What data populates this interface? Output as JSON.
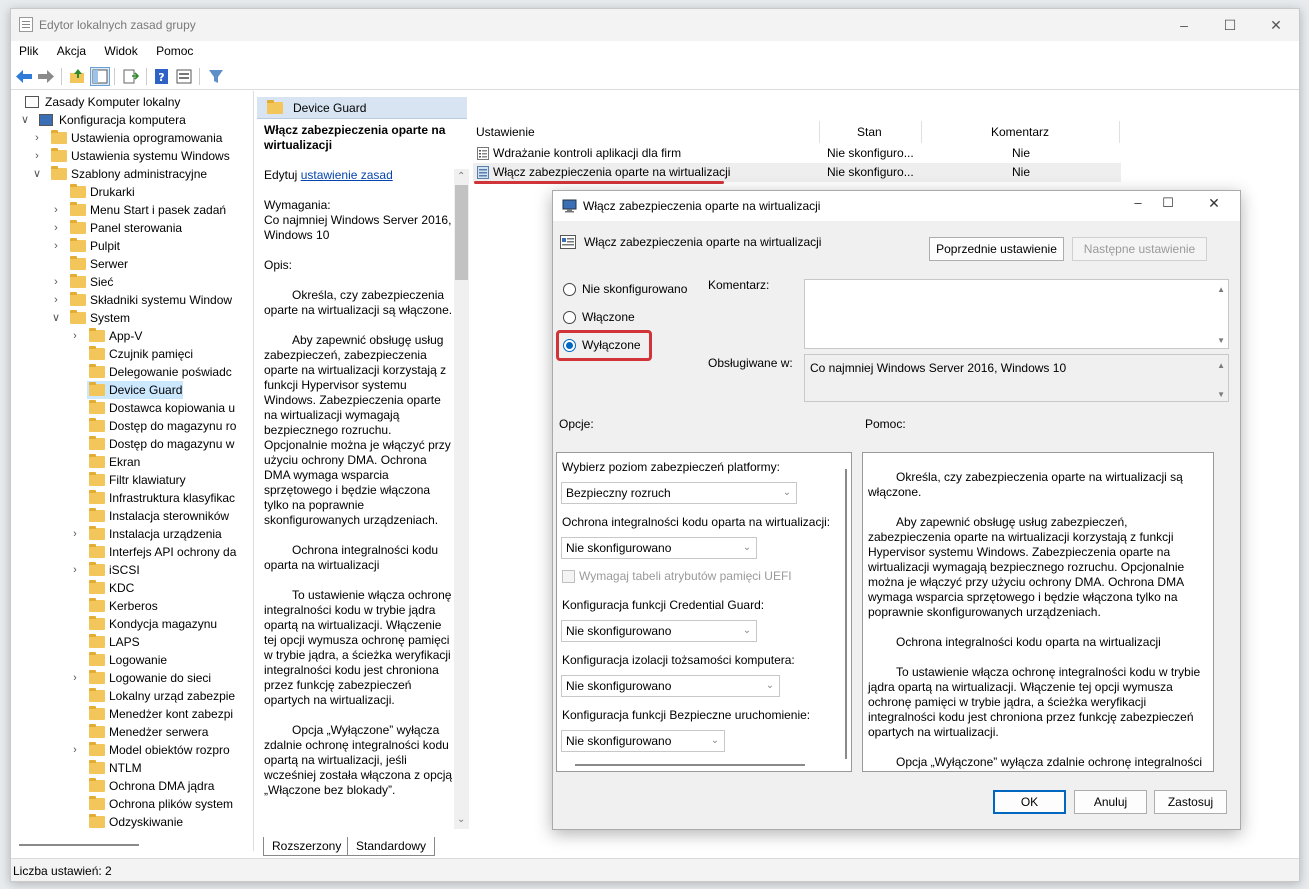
{
  "window": {
    "title": "Edytor lokalnych zasad grupy"
  },
  "menu": [
    "Plik",
    "Akcja",
    "Widok",
    "Pomoc"
  ],
  "tree": {
    "items": [
      {
        "label": "Zasady Komputer lokalny",
        "level": 0,
        "expand": "",
        "icon": "computer-icon"
      },
      {
        "label": "Konfiguracja komputera",
        "level": 0,
        "expand": "open",
        "icon": "computer-icon"
      },
      {
        "label": "Ustawienia oprogramowania",
        "level": 1,
        "expand": "closed",
        "icon": "folder-icon"
      },
      {
        "label": "Ustawienia systemu Windows",
        "level": 1,
        "expand": "closed",
        "icon": "folder-icon"
      },
      {
        "label": "Szablony administracyjne",
        "level": 1,
        "expand": "open",
        "icon": "folder-icon"
      },
      {
        "label": "Drukarki",
        "level": 2,
        "expand": "",
        "icon": "folder-icon"
      },
      {
        "label": "Menu Start i pasek zadań",
        "level": 2,
        "expand": "closed",
        "icon": "folder-icon"
      },
      {
        "label": "Panel sterowania",
        "level": 2,
        "expand": "closed",
        "icon": "folder-icon"
      },
      {
        "label": "Pulpit",
        "level": 2,
        "expand": "closed",
        "icon": "folder-icon"
      },
      {
        "label": "Serwer",
        "level": 2,
        "expand": "",
        "icon": "folder-icon"
      },
      {
        "label": "Sieć",
        "level": 2,
        "expand": "closed",
        "icon": "folder-icon"
      },
      {
        "label": "Składniki systemu Window",
        "level": 2,
        "expand": "closed",
        "icon": "folder-icon"
      },
      {
        "label": "System",
        "level": 2,
        "expand": "open",
        "icon": "folder-icon"
      },
      {
        "label": "App-V",
        "level": 3,
        "expand": "closed",
        "icon": "folder-icon"
      },
      {
        "label": "Czujnik pamięci",
        "level": 3,
        "expand": "",
        "icon": "folder-icon"
      },
      {
        "label": "Delegowanie poświadc",
        "level": 3,
        "expand": "",
        "icon": "folder-icon"
      },
      {
        "label": "Device Guard",
        "level": 3,
        "expand": "",
        "icon": "folder-icon",
        "selected": true
      },
      {
        "label": "Dostawca kopiowania u",
        "level": 3,
        "expand": "",
        "icon": "folder-icon"
      },
      {
        "label": "Dostęp do magazynu ro",
        "level": 3,
        "expand": "",
        "icon": "folder-icon"
      },
      {
        "label": "Dostęp do magazynu w",
        "level": 3,
        "expand": "",
        "icon": "folder-icon"
      },
      {
        "label": "Ekran",
        "level": 3,
        "expand": "",
        "icon": "folder-icon"
      },
      {
        "label": "Filtr klawiatury",
        "level": 3,
        "expand": "",
        "icon": "folder-icon"
      },
      {
        "label": "Infrastruktura klasyfikac",
        "level": 3,
        "expand": "",
        "icon": "folder-icon"
      },
      {
        "label": "Instalacja sterowników",
        "level": 3,
        "expand": "",
        "icon": "folder-icon"
      },
      {
        "label": "Instalacja urządzenia",
        "level": 3,
        "expand": "closed",
        "icon": "folder-icon"
      },
      {
        "label": "Interfejs API ochrony da",
        "level": 3,
        "expand": "",
        "icon": "folder-icon"
      },
      {
        "label": "iSCSI",
        "level": 3,
        "expand": "closed",
        "icon": "folder-icon"
      },
      {
        "label": "KDC",
        "level": 3,
        "expand": "",
        "icon": "folder-icon"
      },
      {
        "label": "Kerberos",
        "level": 3,
        "expand": "",
        "icon": "folder-icon"
      },
      {
        "label": "Kondycja magazynu",
        "level": 3,
        "expand": "",
        "icon": "folder-icon"
      },
      {
        "label": "LAPS",
        "level": 3,
        "expand": "",
        "icon": "folder-icon"
      },
      {
        "label": "Logowanie",
        "level": 3,
        "expand": "",
        "icon": "folder-icon"
      },
      {
        "label": "Logowanie do sieci",
        "level": 3,
        "expand": "closed",
        "icon": "folder-icon"
      },
      {
        "label": "Lokalny urząd zabezpie",
        "level": 3,
        "expand": "",
        "icon": "folder-icon"
      },
      {
        "label": "Menedżer kont zabezpi",
        "level": 3,
        "expand": "",
        "icon": "folder-icon"
      },
      {
        "label": "Menedżer serwera",
        "level": 3,
        "expand": "",
        "icon": "folder-icon"
      },
      {
        "label": "Model obiektów rozpro",
        "level": 3,
        "expand": "closed",
        "icon": "folder-icon"
      },
      {
        "label": "NTLM",
        "level": 3,
        "expand": "",
        "icon": "folder-icon"
      },
      {
        "label": "Ochrona DMA jądra",
        "level": 3,
        "expand": "",
        "icon": "folder-icon"
      },
      {
        "label": "Ochrona plików system",
        "level": 3,
        "expand": "",
        "icon": "folder-icon"
      },
      {
        "label": "Odzyskiwanie",
        "level": 3,
        "expand": "",
        "icon": "folder-icon"
      }
    ]
  },
  "middle": {
    "header": "Device Guard",
    "policy_title": "Włącz zabezpieczenia oparte na wirtualizacji",
    "edit_prefix": "Edytuj",
    "edit_link": "ustawienie zasad",
    "requirements_label": "Wymagania:",
    "requirements": "Co najmniej Windows Server 2016, Windows 10",
    "description_label": "Opis:",
    "paragraphs": [
      "Określa, czy zabezpieczenia oparte na wirtualizacji są włączone.",
      "Aby zapewnić obsługę usług zabezpieczeń, zabezpieczenia oparte na wirtualizacji korzystają z funkcji Hypervisor systemu Windows. Zabezpieczenia oparte na wirtualizacji wymagają bezpiecznego rozruchu. Opcjonalnie można je włączyć przy użyciu ochrony DMA. Ochrona DMA wymaga wsparcia sprzętowego i będzie włączona tylko na poprawnie skonfigurowanych urządzeniach.",
      "Ochrona integralności kodu oparta na wirtualizacji",
      "To ustawienie włącza ochronę integralności kodu w trybie jądra opartą na wirtualizacji. Włączenie tej opcji wymusza ochronę pamięci w trybie jądra, a ścieżka weryfikacji integralności kodu jest chroniona przez funkcję zabezpieczeń opartych na wirtualizacji.",
      "Opcja „Wyłączone” wyłącza zdalnie ochronę integralności kodu opartą na wirtualizacji, jeśli wcześniej została włączona z opcją „Włączone bez blokady”."
    ]
  },
  "list": {
    "columns": [
      "Ustawienie",
      "Stan",
      "Komentarz"
    ],
    "rows": [
      {
        "name": "Wdrażanie kontroli aplikacji dla firm",
        "state": "Nie skonfiguro...",
        "comment": "Nie"
      },
      {
        "name": "Włącz zabezpieczenia oparte na wirtualizacji",
        "state": "Nie skonfiguro...",
        "comment": "Nie"
      }
    ]
  },
  "tabs": [
    "Rozszerzony",
    "Standardowy"
  ],
  "status": "Liczba ustawień: 2",
  "dialog": {
    "title": "Włącz zabezpieczenia oparte na wirtualizacji",
    "subtitle": "Włącz zabezpieczenia oparte na wirtualizacji",
    "prev_button": "Poprzednie ustawienie",
    "next_button": "Następne ustawienie",
    "radios": [
      "Nie skonfigurowano",
      "Włączone",
      "Wyłączone"
    ],
    "selected_radio": "Wyłączone",
    "comment_label": "Komentarz:",
    "supported_label": "Obsługiwane w:",
    "supported_value": "Co najmniej Windows Server 2016, Windows 10",
    "options_label": "Opcje:",
    "help_label": "Pomoc:",
    "options": {
      "platform_label": "Wybierz poziom zabezpieczeń platformy:",
      "platform_value": "Bezpieczny rozruch",
      "hvci_label": "Ochrona integralności kodu oparta na wirtualizacji:",
      "hvci_value": "Nie skonfigurowano",
      "uefi_checkbox": "Wymagaj tabeli atrybutów pamięci UEFI",
      "credguard_label": "Konfiguracja funkcji Credential Guard:",
      "credguard_value": "Nie skonfigurowano",
      "isolation_label": "Konfiguracja izolacji tożsamości komputera:",
      "isolation_value": "Nie skonfigurowano",
      "secure_launch_label": "Konfiguracja funkcji Bezpieczne uruchomienie:",
      "secure_launch_value": "Nie skonfigurowano"
    },
    "help_paragraphs": [
      "Określa, czy zabezpieczenia oparte na wirtualizacji są włączone.",
      "Aby zapewnić obsługę usług zabezpieczeń, zabezpieczenia oparte na wirtualizacji korzystają z funkcji Hypervisor systemu Windows. Zabezpieczenia oparte na wirtualizacji wymagają bezpiecznego rozruchu. Opcjonalnie można je włączyć przy użyciu ochrony DMA. Ochrona DMA wymaga wsparcia sprzętowego i będzie włączona tylko na poprawnie skonfigurowanych urządzeniach.",
      "Ochrona integralności kodu oparta na wirtualizacji",
      "To ustawienie włącza ochronę integralności kodu w trybie jądra opartą na wirtualizacji. Włączenie tej opcji wymusza ochronę pamięci w trybie jądra, a ścieżka weryfikacji integralności kodu jest chroniona przez funkcję zabezpieczeń opartych na wirtualizacji.",
      "Opcja „Wyłączone” wyłącza zdalnie ochronę integralności"
    ],
    "ok": "OK",
    "cancel": "Anuluj",
    "apply": "Zastosuj"
  },
  "colors": {
    "accent": "#0067c0",
    "highlight": "#d13438",
    "selection": "#cce8ff"
  }
}
